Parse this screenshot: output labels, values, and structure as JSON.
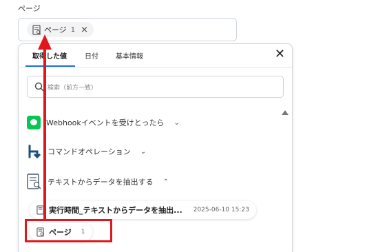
{
  "field": {
    "label": "ページ"
  },
  "selected_chip": {
    "label": "ページ",
    "number": "1",
    "close": "×"
  },
  "panel": {
    "close": "✕",
    "tabs": [
      {
        "label": "取得した値",
        "active": true
      },
      {
        "label": "日付",
        "active": false
      },
      {
        "label": "基本情報",
        "active": false
      }
    ],
    "search": {
      "placeholder": "検索（前方一致）"
    },
    "groups": [
      {
        "label": "Webhookイベントを受けとったら",
        "icon": "line-icon"
      },
      {
        "label": "コマンドオペレーション",
        "icon": "command-icon"
      },
      {
        "label": "テキストからデータを抽出する",
        "icon": "document-search-icon"
      }
    ],
    "items": [
      {
        "title": "実行時間_テキストからデータを抽出...",
        "date": "2025-06-10 15:23"
      },
      {
        "title": "ページ",
        "number": "1"
      }
    ]
  },
  "colors": {
    "accent": "#1f6fd9",
    "highlight": "#e0181c",
    "line_green": "#06c755"
  }
}
